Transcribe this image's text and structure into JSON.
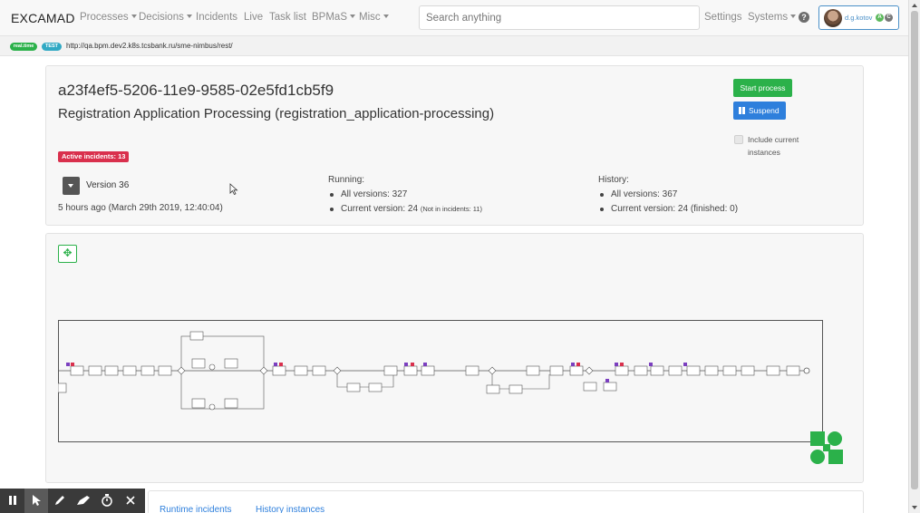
{
  "navbar": {
    "brand": "EXCAMAD",
    "menu": [
      {
        "label": "Processes",
        "dropdown": true
      },
      {
        "label": "Decisions",
        "dropdown": true
      },
      {
        "label": "Incidents",
        "dropdown": false
      },
      {
        "label": "Live",
        "dropdown": false
      },
      {
        "label": "Task list",
        "dropdown": false
      },
      {
        "label": "BPMaS",
        "dropdown": true
      },
      {
        "label": "Misc",
        "dropdown": true
      }
    ],
    "search_placeholder": "Search anything",
    "settings": "Settings",
    "systems": "Systems",
    "help_icon": "question-circle",
    "user": {
      "name": "d.g.kotov",
      "badges": [
        "A",
        "C"
      ]
    }
  },
  "env": {
    "badges": [
      "real.time",
      "TEST"
    ],
    "url": "http://qa.bpm.dev2.k8s.tcsbank.ru/sme-nimbus/rest/"
  },
  "process": {
    "id": "a23f4ef5-5206-11e9-9585-02e5fd1cb5f9",
    "name": "Registration Application Processing (registration_application-processing)",
    "active_incidents": "Active incidents: 13",
    "version": "Version 36",
    "deployed": "5 hours ago (March 29th 2019, 12:40:04)",
    "running": {
      "title": "Running:",
      "all_versions": "All versions: 327",
      "current_version": "Current version: 24",
      "current_note": "(Not in incidents: 11)"
    },
    "history": {
      "title": "History:",
      "all_versions": "All versions: 367",
      "current_version": "Current version: 24 (finished: 0)"
    }
  },
  "actions": {
    "start": "Start process",
    "suspend": "Suspend",
    "include_current": "Include current instances"
  },
  "diagram": {
    "move_icon": "arrows-move",
    "logo_icon": "puzzle-logo"
  },
  "tabs": [
    "Runtime incidents",
    "History instances"
  ],
  "toolbar": {
    "tools": [
      "pause-icon",
      "pointer-icon",
      "pen-icon",
      "highlighter-icon",
      "timer-icon",
      "close-icon"
    ]
  },
  "colors": {
    "green": "#2bb14a",
    "blue": "#2e7fdc",
    "red": "#d9304d",
    "navbar_bg": "#f8f8f8"
  }
}
